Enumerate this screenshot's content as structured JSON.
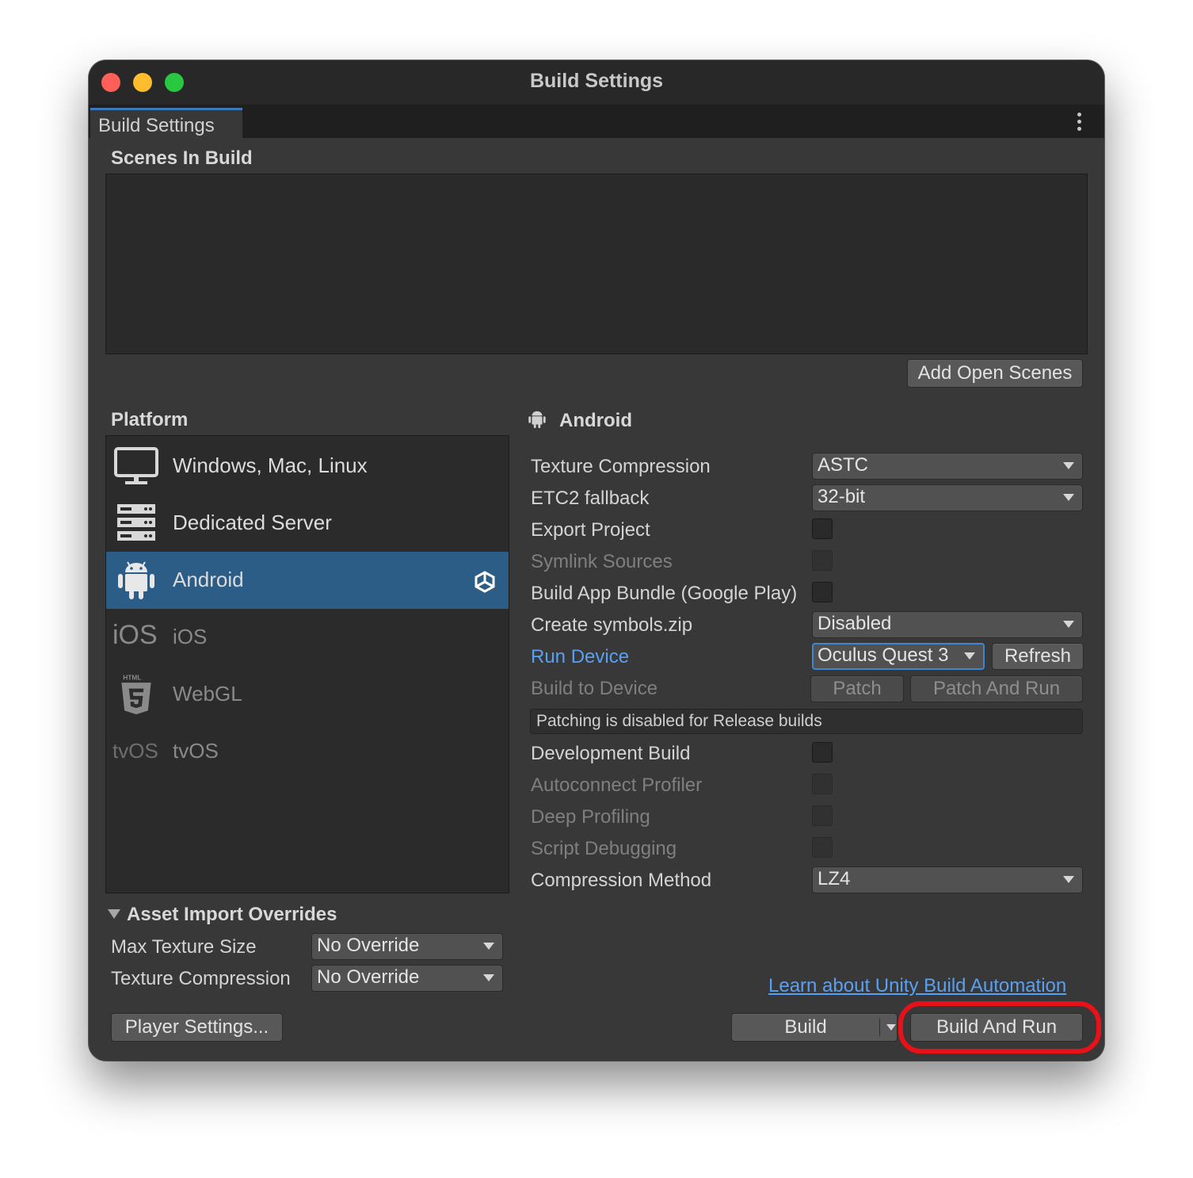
{
  "window": {
    "title": "Build Settings"
  },
  "tab": {
    "label": "Build Settings"
  },
  "scenes": {
    "header": "Scenes In Build",
    "add_open_scenes": "Add Open Scenes"
  },
  "platform": {
    "header": "Platform",
    "items": [
      {
        "label": "Windows, Mac, Linux",
        "icon": "monitor-icon"
      },
      {
        "label": "Dedicated Server",
        "icon": "server-icon"
      },
      {
        "label": "Android",
        "icon": "android-icon",
        "selected": true,
        "badge_icon": "unity-logo-icon"
      },
      {
        "label": "iOS",
        "icon_text": "iOS"
      },
      {
        "label": "WebGL",
        "icon": "html5-icon",
        "icon_text": "HTML"
      },
      {
        "label": "tvOS",
        "icon_text": "tvOS"
      }
    ]
  },
  "android": {
    "header": "Android",
    "texture_compression": {
      "label": "Texture Compression",
      "value": "ASTC"
    },
    "etc2_fallback": {
      "label": "ETC2 fallback",
      "value": "32-bit"
    },
    "export_project": {
      "label": "Export Project"
    },
    "symlink_sources": {
      "label": "Symlink Sources"
    },
    "build_app_bundle": {
      "label": "Build App Bundle (Google Play)"
    },
    "create_symbols": {
      "label": "Create symbols.zip",
      "value": "Disabled"
    },
    "run_device": {
      "label": "Run Device",
      "value": "Oculus Quest 3",
      "refresh": "Refresh"
    },
    "build_to_device": {
      "label": "Build to Device",
      "patch": "Patch",
      "patch_and_run": "Patch And Run"
    },
    "patch_note": "Patching is disabled for Release builds",
    "development_build": {
      "label": "Development Build"
    },
    "autoconnect_profiler": {
      "label": "Autoconnect Profiler"
    },
    "deep_profiling": {
      "label": "Deep Profiling"
    },
    "script_debugging": {
      "label": "Script Debugging"
    },
    "compression_method": {
      "label": "Compression Method",
      "value": "LZ4"
    }
  },
  "overrides": {
    "header": "Asset Import Overrides",
    "max_texture_size": {
      "label": "Max Texture Size",
      "value": "No Override"
    },
    "texture_compression": {
      "label": "Texture Compression",
      "value": "No Override"
    }
  },
  "footer": {
    "player_settings": "Player Settings...",
    "learn_link": "Learn about Unity Build Automation",
    "build": "Build",
    "build_and_run": "Build And Run"
  },
  "colors": {
    "accent_selected": "#2c5d87",
    "link": "#5aa0f2",
    "highlight_ring": "#e8111a"
  }
}
